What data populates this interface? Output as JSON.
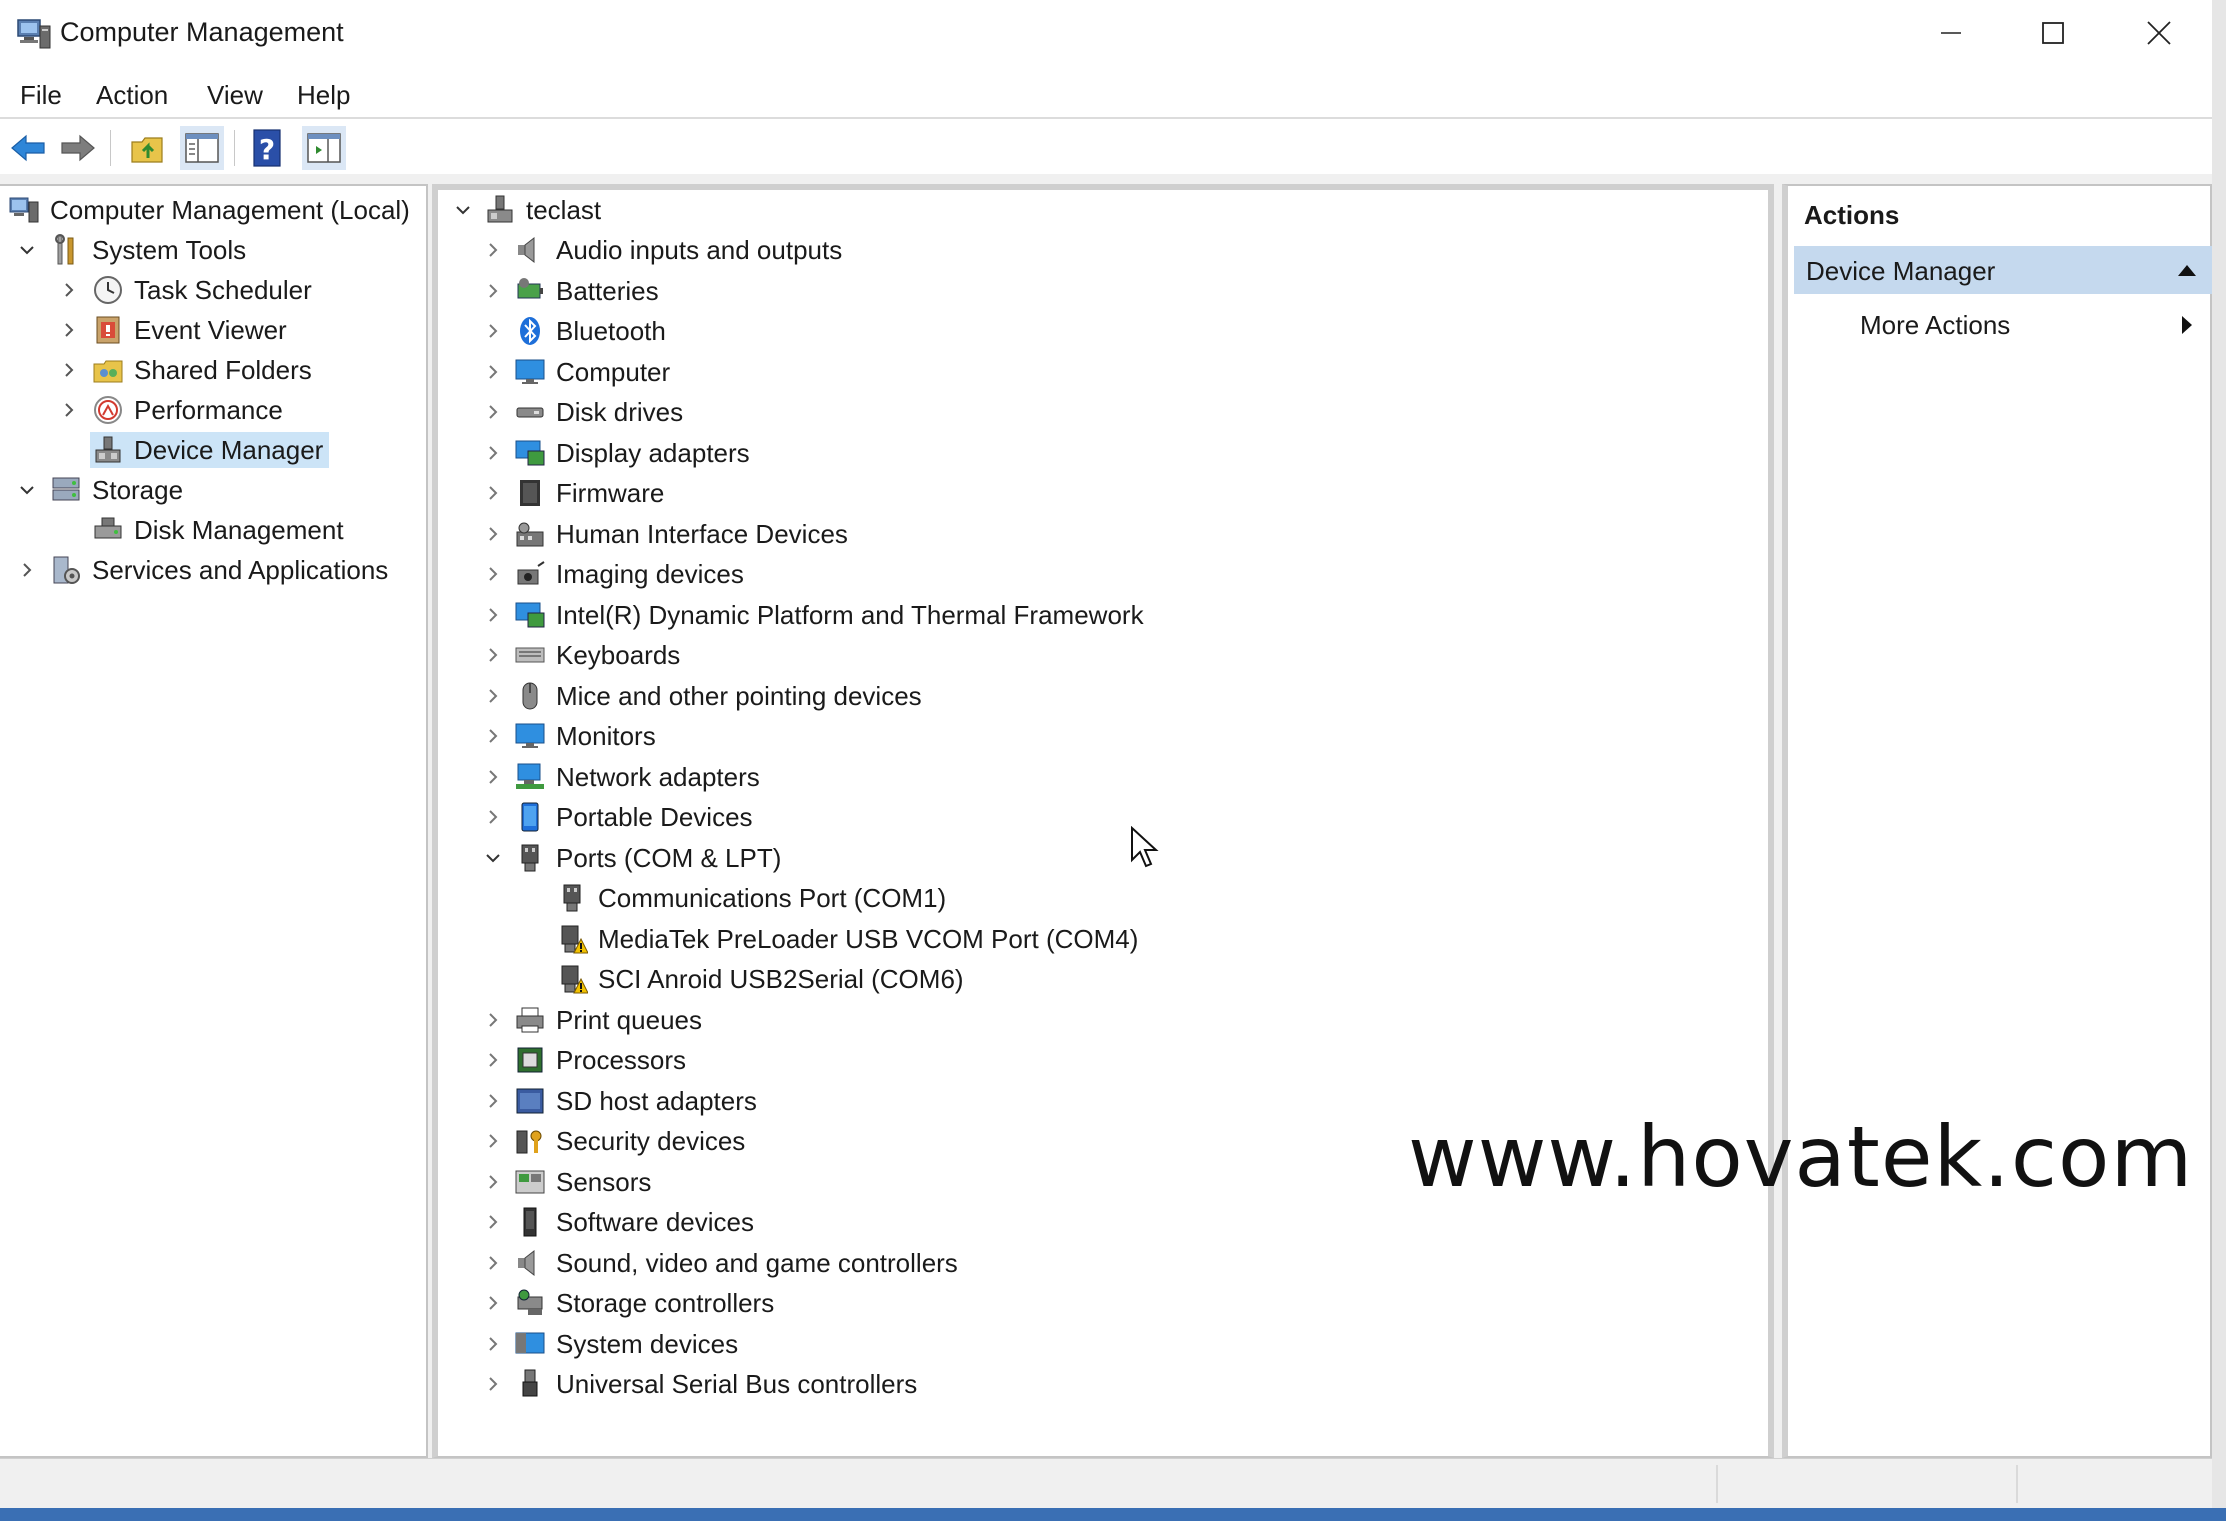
{
  "window": {
    "title": "Computer Management"
  },
  "menu": [
    "File",
    "Action",
    "View",
    "Help"
  ],
  "toolbar": {
    "buttons": [
      "back-icon",
      "forward-icon",
      "up-folder-icon",
      "show-hide-tree-icon",
      "help-icon",
      "show-hide-action-pane-icon"
    ]
  },
  "tree": {
    "root": "Computer Management (Local)",
    "system_tools": "System Tools",
    "task_scheduler": "Task Scheduler",
    "event_viewer": "Event Viewer",
    "shared_folders": "Shared Folders",
    "performance": "Performance",
    "device_manager": "Device Manager",
    "storage": "Storage",
    "disk_management": "Disk Management",
    "services_apps": "Services and Applications"
  },
  "devices": {
    "root": "teclast",
    "categories": [
      "Audio inputs and outputs",
      "Batteries",
      "Bluetooth",
      "Computer",
      "Disk drives",
      "Display adapters",
      "Firmware",
      "Human Interface Devices",
      "Imaging devices",
      "Intel(R) Dynamic Platform and Thermal Framework",
      "Keyboards",
      "Mice and other pointing devices",
      "Monitors",
      "Network adapters",
      "Portable Devices",
      "Ports (COM & LPT)",
      "Communications Port (COM1)",
      "MediaTek PreLoader USB VCOM Port (COM4)",
      "SCI Anroid USB2Serial (COM6)",
      "Print queues",
      "Processors",
      "SD host adapters",
      "Security devices",
      "Sensors",
      "Software devices",
      "Sound, video and game controllers",
      "Storage controllers",
      "System devices",
      "Universal Serial Bus controllers"
    ]
  },
  "actions": {
    "header": "Actions",
    "section": "Device Manager",
    "more": "More Actions"
  },
  "watermark": "www.hovatek.com",
  "colors": {
    "selection": "#cce4f7",
    "actions_section": "#c5d9ee",
    "warning": "#f2c200"
  }
}
